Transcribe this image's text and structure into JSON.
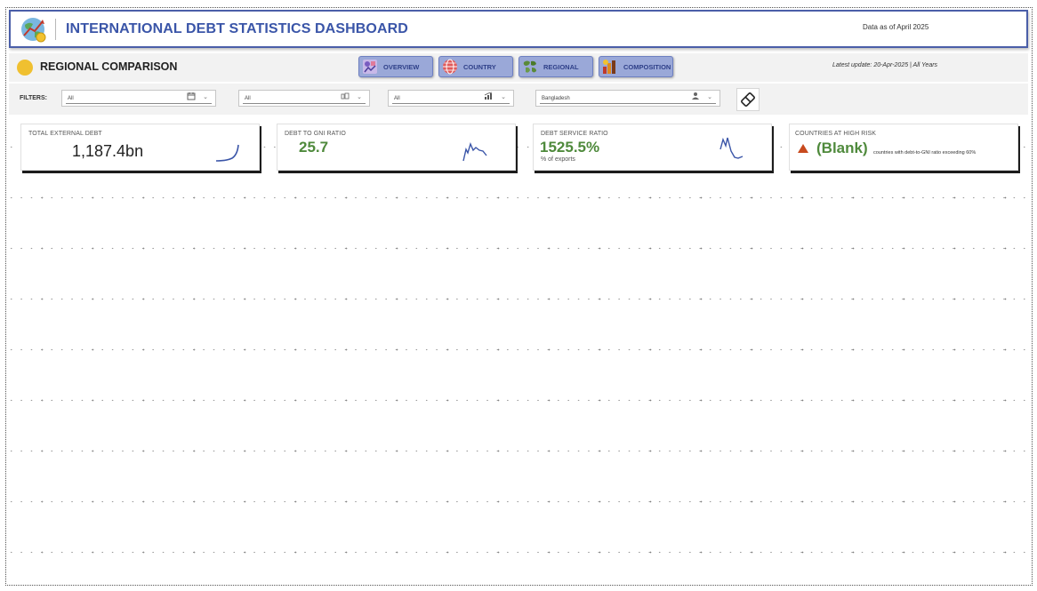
{
  "title_bar": {
    "title": "INTERNATIONAL DEBT STATISTICS DASHBOARD",
    "date_note": "Data as of April 2025",
    "logo_icon": "globe-chart-logo-icon"
  },
  "header": {
    "title": "REGIONAL COMPARISON",
    "update_text": "Latest update: 20-Apr-2025 | All Years",
    "nav": [
      {
        "label": "OVERVIEW",
        "icon": "overview-icon"
      },
      {
        "label": "COUNTRY",
        "icon": "globe-icon"
      },
      {
        "label": "REGIONAL",
        "icon": "regional-map-icon"
      },
      {
        "label": "COMPOSITION",
        "icon": "composition-icon"
      }
    ]
  },
  "filters": {
    "label": "FILTERS:",
    "items": [
      {
        "value": "All",
        "icon": "calendar-icon"
      },
      {
        "value": "All",
        "icon": "income-group-icon"
      },
      {
        "value": "All",
        "icon": "bar-chart-icon"
      },
      {
        "value": "Bangladesh",
        "icon": "person-icon"
      }
    ],
    "clear_icon": "eraser-icon"
  },
  "cards": [
    {
      "label": "TOTAL EXTERNAL DEBT",
      "value": "1,187.4bn",
      "sub": ""
    },
    {
      "label": "DEBT TO GNI RATIO",
      "value": "25.7",
      "sub": ""
    },
    {
      "label": "DEBT SERVICE RATIO",
      "value": "1525.5%",
      "sub": "% of exports"
    },
    {
      "label": "COUNTRIES AT HIGH RISK",
      "value": "(Blank)",
      "sub": "countries with debt-to-GNI ratio exceeding 60%"
    }
  ],
  "colors": {
    "accent": "#3a55a8",
    "value_green": "#4f8a3c",
    "risk_triangle": "#c84a1e",
    "nav_button": "#9aa8d8",
    "header_dot": "#f0c030"
  }
}
